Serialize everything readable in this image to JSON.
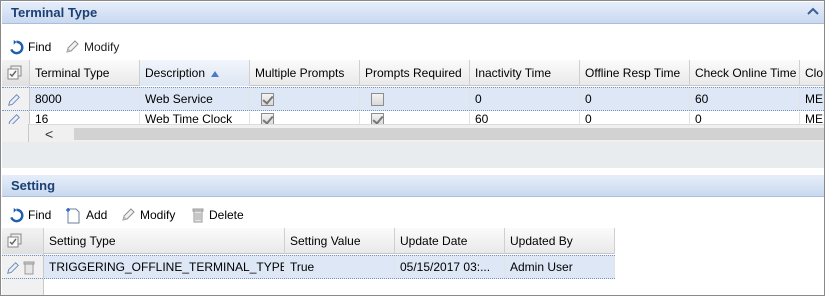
{
  "terminal_type": {
    "title": "Terminal Type",
    "toolbar": {
      "find": "Find",
      "modify": "Modify"
    },
    "columns": [
      "Terminal Type",
      "Description",
      "Multiple Prompts",
      "Prompts Required",
      "Inactivity Time",
      "Offline Resp Time",
      "Check Online Time",
      "Clo"
    ],
    "sort_column": "Description",
    "rows": [
      {
        "terminal_type": "8000",
        "description": "Web Service",
        "multiple_prompts": true,
        "prompts_required": false,
        "inactivity_time": "0",
        "offline_resp_time": "0",
        "check_online_time": "60",
        "clock": "MEI"
      },
      {
        "terminal_type": "16",
        "description": "Web Time Clock",
        "multiple_prompts": true,
        "prompts_required": true,
        "inactivity_time": "60",
        "offline_resp_time": "0",
        "check_online_time": "0",
        "clock": "MEI"
      }
    ],
    "scroll_arrow": "<"
  },
  "setting": {
    "title": "Setting",
    "toolbar": {
      "find": "Find",
      "add": "Add",
      "modify": "Modify",
      "delete": "Delete"
    },
    "columns": [
      "Setting Type",
      "Setting Value",
      "Update Date",
      "Updated By"
    ],
    "rows": [
      {
        "setting_type": "TRIGGERING_OFFLINE_TERMINAL_TYPE",
        "setting_value": "True",
        "update_date": "05/15/2017 03:...",
        "updated_by": "Admin User"
      }
    ]
  },
  "colors": {
    "header_text": "#1c3f74",
    "selected_row": "#dde7f6",
    "find_icon": "#1f5fb0"
  },
  "icons": [
    "find-icon",
    "modify-icon",
    "add-icon",
    "delete-icon",
    "collapse-icon",
    "column-menu-icon",
    "edit-row-icon",
    "delete-row-icon",
    "sort-asc-icon"
  ]
}
